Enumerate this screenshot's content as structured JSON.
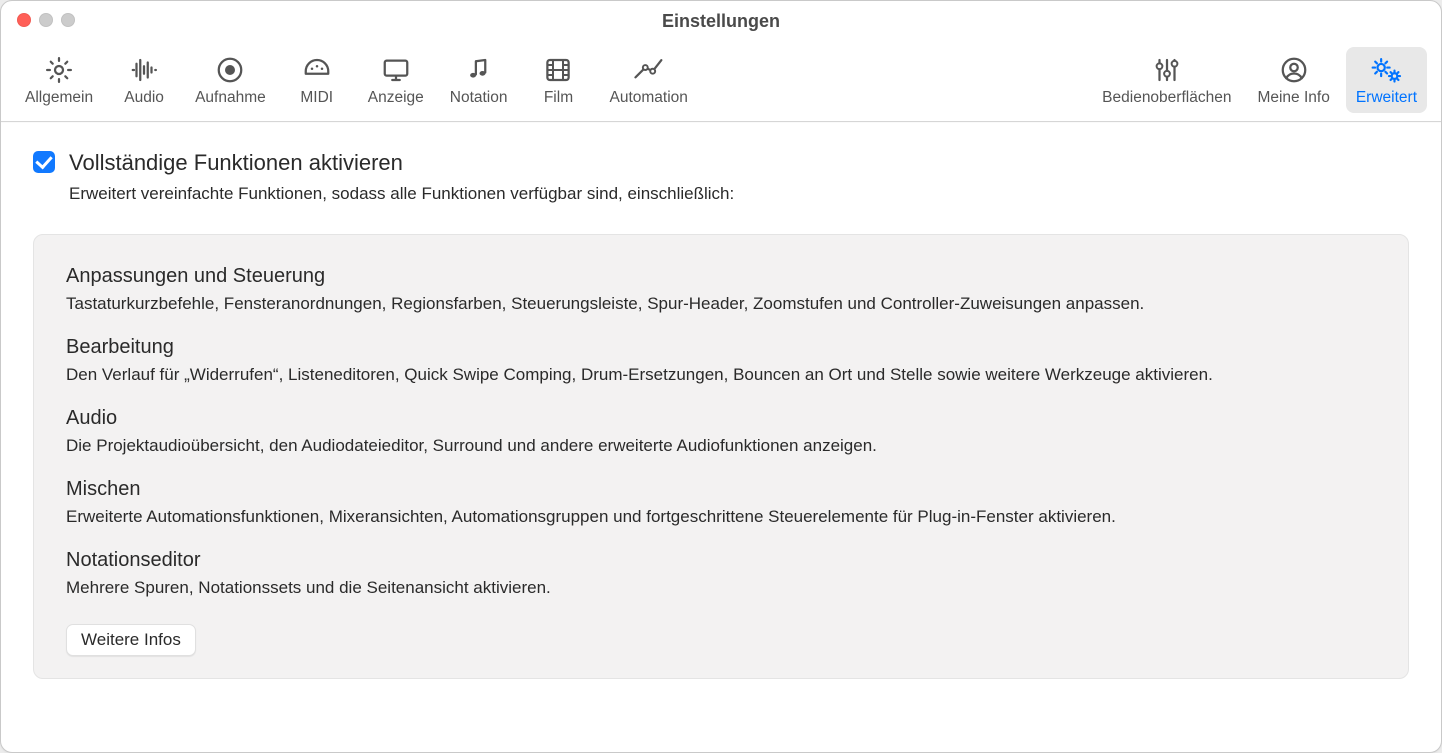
{
  "window": {
    "title": "Einstellungen"
  },
  "toolbar": {
    "items": {
      "general": {
        "label": "Allgemein"
      },
      "audio": {
        "label": "Audio"
      },
      "record": {
        "label": "Aufnahme"
      },
      "midi": {
        "label": "MIDI"
      },
      "display": {
        "label": "Anzeige"
      },
      "notation": {
        "label": "Notation"
      },
      "film": {
        "label": "Film"
      },
      "automation": {
        "label": "Automation"
      },
      "surfaces": {
        "label": "Bedienoberflächen"
      },
      "myinfo": {
        "label": "Meine Info"
      },
      "advanced": {
        "label": "Erweitert"
      }
    }
  },
  "option": {
    "checked": true,
    "title": "Vollständige Funktionen aktivieren",
    "description": "Erweitert vereinfachte Funktionen, sodass alle Funktionen verfügbar sind, einschließlich:"
  },
  "features": [
    {
      "title": "Anpassungen und Steuerung",
      "desc": "Tastaturkurzbefehle, Fensteranordnungen, Regionsfarben, Steuerungsleiste, Spur-Header, Zoomstufen und Controller-Zuweisungen anpassen."
    },
    {
      "title": "Bearbeitung",
      "desc": "Den Verlauf für „Widerrufen“, Listeneditoren, Quick Swipe Comping, Drum-Ersetzungen, Bouncen an Ort und Stelle sowie weitere Werkzeuge aktivieren."
    },
    {
      "title": "Audio",
      "desc": "Die Projektaudioübersicht, den Audiodateieditor, Surround und andere erweiterte Audiofunktionen anzeigen."
    },
    {
      "title": "Mischen",
      "desc": "Erweiterte Automationsfunktionen, Mixeransichten, Automationsgruppen und fortgeschrittene Steuerelemente für Plug-in-Fenster aktivieren."
    },
    {
      "title": "Notationseditor",
      "desc": "Mehrere Spuren, Notationssets und die Seitenansicht aktivieren."
    }
  ],
  "buttons": {
    "more_info": "Weitere Infos"
  }
}
